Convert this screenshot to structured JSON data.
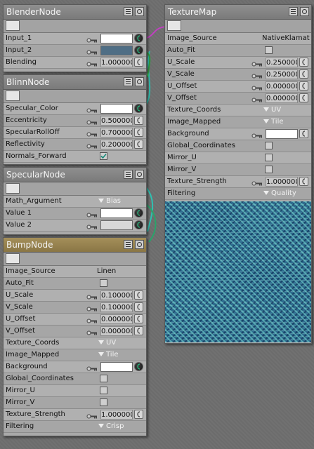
{
  "colors": {
    "wire_magenta": "#c040c0",
    "wire_teal": "#30c0b0",
    "wire_green": "#30a040",
    "bump_header": "#9c8650",
    "texture_blue": "#2f6d8f"
  },
  "blender": {
    "title": "BlenderNode",
    "rows": [
      {
        "label": "Input_1",
        "kind": "color",
        "color": "#ffffff"
      },
      {
        "label": "Input_2",
        "kind": "color",
        "color": "#4f6e85"
      },
      {
        "label": "Blending",
        "kind": "number",
        "value": "1.000000"
      }
    ]
  },
  "blinn": {
    "title": "BlinnNode",
    "rows": [
      {
        "label": "Specular_Color",
        "kind": "color",
        "color": "#ffffff"
      },
      {
        "label": "Eccentricity",
        "kind": "number",
        "value": "0.500000"
      },
      {
        "label": "SpecularRollOff",
        "kind": "number",
        "value": "0.700000"
      },
      {
        "label": "Reflectivity",
        "kind": "number",
        "value": "0.200000"
      },
      {
        "label": "Normals_Forward",
        "kind": "check",
        "checked": true
      }
    ]
  },
  "specular": {
    "title": "SpecularNode",
    "rows": [
      {
        "label": "Math_Argument",
        "kind": "dropdown",
        "value": "Bias"
      },
      {
        "label": "Value 1",
        "kind": "color",
        "color": "#ffffff"
      },
      {
        "label": "Value 2",
        "kind": "color",
        "color": "#d8d8d8"
      }
    ]
  },
  "bump": {
    "title": "BumpNode",
    "rows": [
      {
        "label": "Image_Source",
        "kind": "text",
        "value": "Linen"
      },
      {
        "label": "Auto_Fit",
        "kind": "check",
        "checked": false
      },
      {
        "label": "U_Scale",
        "kind": "number",
        "value": "0.100000"
      },
      {
        "label": "V_Scale",
        "kind": "number",
        "value": "0.100000"
      },
      {
        "label": "U_Offset",
        "kind": "number",
        "value": "0.000000"
      },
      {
        "label": "V_Offset",
        "kind": "number",
        "value": "0.000000"
      },
      {
        "label": "Texture_Coords",
        "kind": "dropdown",
        "value": "UV"
      },
      {
        "label": "Image_Mapped",
        "kind": "dropdown",
        "value": "Tile"
      },
      {
        "label": "Background",
        "kind": "color",
        "color": "#ffffff"
      },
      {
        "label": "Global_Coordinates",
        "kind": "check",
        "checked": false
      },
      {
        "label": "Mirror_U",
        "kind": "check",
        "checked": false
      },
      {
        "label": "Mirror_V",
        "kind": "check",
        "checked": false
      },
      {
        "label": "Texture_Strength",
        "kind": "number",
        "value": "1.000000"
      },
      {
        "label": "Filtering",
        "kind": "dropdown",
        "value": "Crisp"
      }
    ]
  },
  "texturemap": {
    "title": "TextureMap",
    "rows": [
      {
        "label": "Image_Source",
        "kind": "text",
        "value": "NativeKlamathFa"
      },
      {
        "label": "Auto_Fit",
        "kind": "check",
        "checked": false
      },
      {
        "label": "U_Scale",
        "kind": "number",
        "value": "0.250000"
      },
      {
        "label": "V_Scale",
        "kind": "number",
        "value": "0.250000"
      },
      {
        "label": "U_Offset",
        "kind": "number",
        "value": "0.000000"
      },
      {
        "label": "V_Offset",
        "kind": "number",
        "value": "0.000000"
      },
      {
        "label": "Texture_Coords",
        "kind": "dropdown",
        "value": "UV"
      },
      {
        "label": "Image_Mapped",
        "kind": "dropdown",
        "value": "Tile"
      },
      {
        "label": "Background",
        "kind": "color",
        "color": "#ffffff"
      },
      {
        "label": "Global_Coordinates",
        "kind": "check",
        "checked": false
      },
      {
        "label": "Mirror_U",
        "kind": "check",
        "checked": false
      },
      {
        "label": "Mirror_V",
        "kind": "check",
        "checked": false
      },
      {
        "label": "Texture_Strength",
        "kind": "number",
        "value": "1.000000"
      },
      {
        "label": "Filtering",
        "kind": "dropdown",
        "value": "Quality"
      }
    ]
  }
}
